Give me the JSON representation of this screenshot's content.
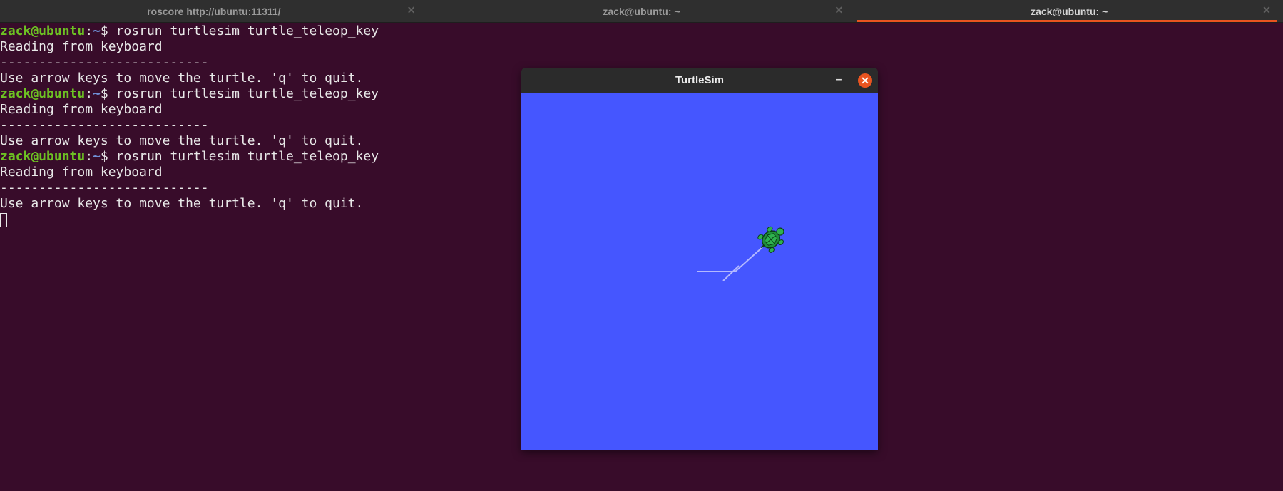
{
  "tabs": [
    {
      "label": "roscore http://ubuntu:11311/",
      "active": false,
      "close_icon": "close-icon"
    },
    {
      "label": "zack@ubuntu: ~",
      "active": false,
      "close_icon": "close-icon"
    },
    {
      "label": "zack@ubuntu: ~",
      "active": true,
      "close_icon": "close-icon"
    }
  ],
  "tab_close_glyph": "✕",
  "terminal": {
    "prompt_user": "zack@ubuntu",
    "prompt_sep": ":",
    "prompt_path": "~",
    "prompt_end": "$ ",
    "command": "rosrun turtlesim turtle_teleop_key",
    "reading": "Reading from keyboard",
    "divider": "---------------------------",
    "instructions": "Use arrow keys to move the turtle. 'q' to quit."
  },
  "turtlesim": {
    "title": "TurtleSim",
    "minimize_glyph": "–",
    "close_glyph": "✕",
    "background_color": "#4556ff",
    "pen_color": "#b3b8ff"
  },
  "colors": {
    "terminal_bg": "#380c2a",
    "prompt_user": "#6dc223",
    "prompt_path": "#6f8fd6",
    "accent": "#e95420"
  }
}
